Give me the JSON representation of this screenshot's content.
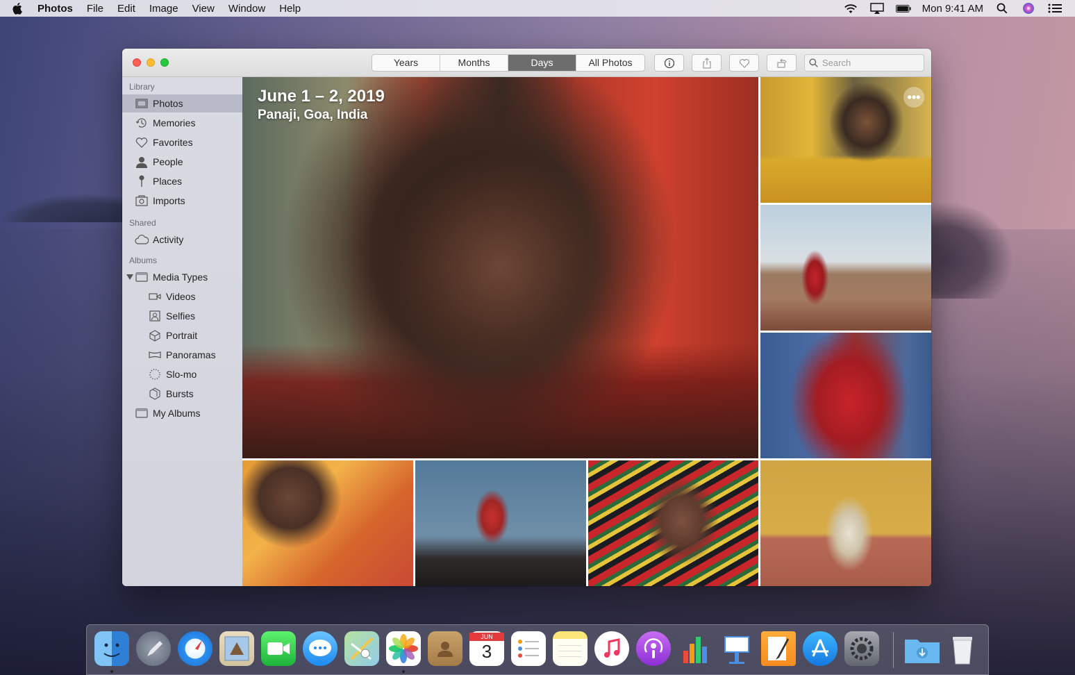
{
  "menubar": {
    "app": "Photos",
    "menus": [
      "File",
      "Edit",
      "Image",
      "View",
      "Window",
      "Help"
    ],
    "clock": "Mon 9:41 AM",
    "icons": [
      "wifi-icon",
      "airplay-icon",
      "battery-icon",
      "spotlight-icon",
      "siri-icon",
      "notification-center-icon"
    ]
  },
  "toolbar": {
    "tabs": [
      "Years",
      "Months",
      "Days",
      "All Photos"
    ],
    "active_tab": "Days",
    "search_placeholder": "Search",
    "buttons": [
      "info-icon",
      "share-icon",
      "favorite-icon",
      "rotate-icon"
    ]
  },
  "sidebar": {
    "library_header": "Library",
    "library": [
      {
        "label": "Photos",
        "icon": "photos-icon",
        "selected": true
      },
      {
        "label": "Memories",
        "icon": "memories-icon"
      },
      {
        "label": "Favorites",
        "icon": "heart-icon"
      },
      {
        "label": "People",
        "icon": "person-icon"
      },
      {
        "label": "Places",
        "icon": "pin-icon"
      },
      {
        "label": "Imports",
        "icon": "imports-icon"
      }
    ],
    "shared_header": "Shared",
    "shared": [
      {
        "label": "Activity",
        "icon": "cloud-icon"
      }
    ],
    "albums_header": "Albums",
    "albums": [
      {
        "label": "Media Types",
        "icon": "folder-icon"
      },
      {
        "label": "Videos",
        "icon": "video-icon"
      },
      {
        "label": "Selfies",
        "icon": "selfie-icon"
      },
      {
        "label": "Portrait",
        "icon": "cube-icon"
      },
      {
        "label": "Panoramas",
        "icon": "panorama-icon"
      },
      {
        "label": "Slo-mo",
        "icon": "slomo-icon"
      },
      {
        "label": "Bursts",
        "icon": "bursts-icon"
      },
      {
        "label": "My Albums",
        "icon": "folder-icon"
      }
    ]
  },
  "main": {
    "date_title": "June 1 – 2, 2019",
    "location": "Panaji, Goa, India",
    "more_button": "•••"
  },
  "dock": {
    "apps": [
      "Finder",
      "Launchpad",
      "Safari",
      "Mail",
      "FaceTime",
      "Messages",
      "Maps",
      "Photos",
      "Contacts",
      "Calendar",
      "Reminders",
      "Notes",
      "Music",
      "Podcasts",
      "Numbers",
      "Keynote",
      "Pages",
      "App Store",
      "System Preferences",
      "Downloads",
      "Trash"
    ],
    "calendar_month": "JUN",
    "calendar_day": "3"
  }
}
